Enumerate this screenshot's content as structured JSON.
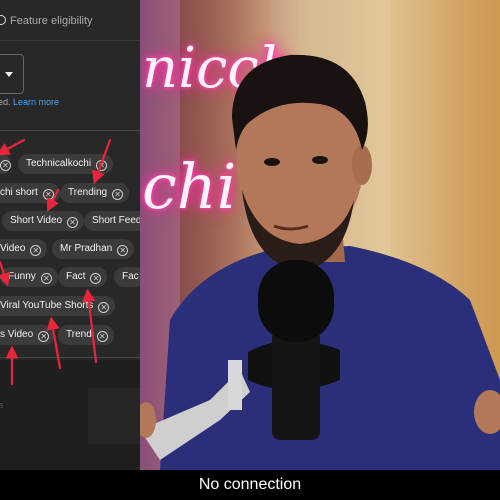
{
  "studio": {
    "tab_title": "Feature eligibility",
    "helper_text": "ed.",
    "learn_more": "Learn more",
    "tags": [
      {
        "label": "Technicalkochi"
      },
      {
        "label": "chi short"
      },
      {
        "label": "Trending"
      },
      {
        "label": "Short Video"
      },
      {
        "label": "Short Feed"
      },
      {
        "label": "Video"
      },
      {
        "label": "Mr Pradhan"
      },
      {
        "label": "Funny"
      },
      {
        "label": "Fact"
      },
      {
        "label": "Fac"
      },
      {
        "label": "Viral YouTube Shorts"
      },
      {
        "label": "s Video"
      },
      {
        "label": "Trend"
      }
    ],
    "lower_faint": "es"
  },
  "video": {
    "neon_line1": "nicch",
    "neon_line2": "chi"
  },
  "status": {
    "message": "No connection"
  },
  "colors": {
    "arrow": "#e8253a",
    "chip_bg": "#3b3b3b",
    "panel_bg": "#282828",
    "link": "#3ea6ff"
  }
}
